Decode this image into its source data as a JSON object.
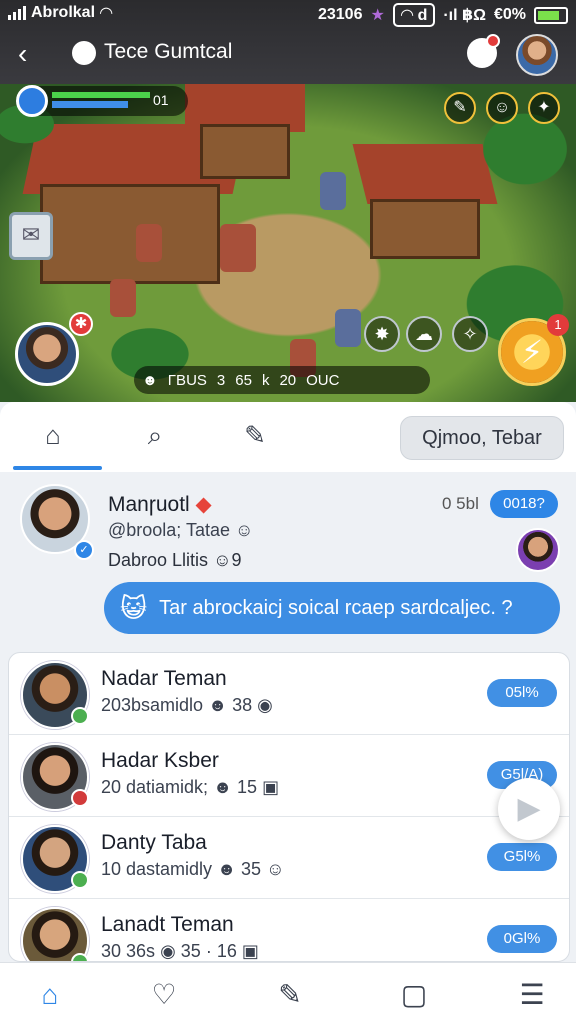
{
  "status_bar": {
    "carrier": "Abrolkal",
    "time": "23106",
    "right_text": "·ıl ฿Ω",
    "battery": "€0%"
  },
  "header": {
    "back_icon": "chevron-left-icon",
    "app_title": "Tece Gumtcal"
  },
  "game": {
    "hud_level": "01",
    "resources": [
      "ΓBUS",
      "3",
      "65",
      "k",
      "20",
      "OUC"
    ],
    "power_badge": "1"
  },
  "tabs": {
    "items": [
      "home-icon",
      "search-icon",
      "compose-icon"
    ],
    "action_label": "Qjmoo, Tebar"
  },
  "post": {
    "author": "Manɼuotl",
    "handle": "@broola; Tatae",
    "line": "Dabroo Llitis",
    "line_suffix": "9",
    "time": "0 5bl",
    "badge": "0018?",
    "message": "Tar abrockaicj soical rcaep sardcaljec. ?"
  },
  "friends": [
    {
      "name": "Nadar Teman",
      "sub": "203bsamidlo",
      "count": "38",
      "badge": "05l%",
      "status_color": "#4caf50"
    },
    {
      "name": "Hadar Ksber",
      "sub": "20 datiamidk;",
      "count": "15",
      "badge": "G5l/A)",
      "status_color": "#d23b3b"
    },
    {
      "name": "Danty Taba",
      "sub": "10 dastamidly",
      "count": "35",
      "badge": "G5l%",
      "status_color": "#4caf50"
    },
    {
      "name": "Lanadt Teman",
      "sub": "30 36s",
      "count": "35 · 16",
      "badge": "0Gl%",
      "status_color": "#4caf50"
    }
  ],
  "bottom_nav": [
    "home-icon",
    "heart-icon",
    "compose-icon",
    "notes-icon",
    "menu-icon"
  ],
  "colors": {
    "accent": "#2e86e6",
    "header_bg": "#2f2f33"
  }
}
